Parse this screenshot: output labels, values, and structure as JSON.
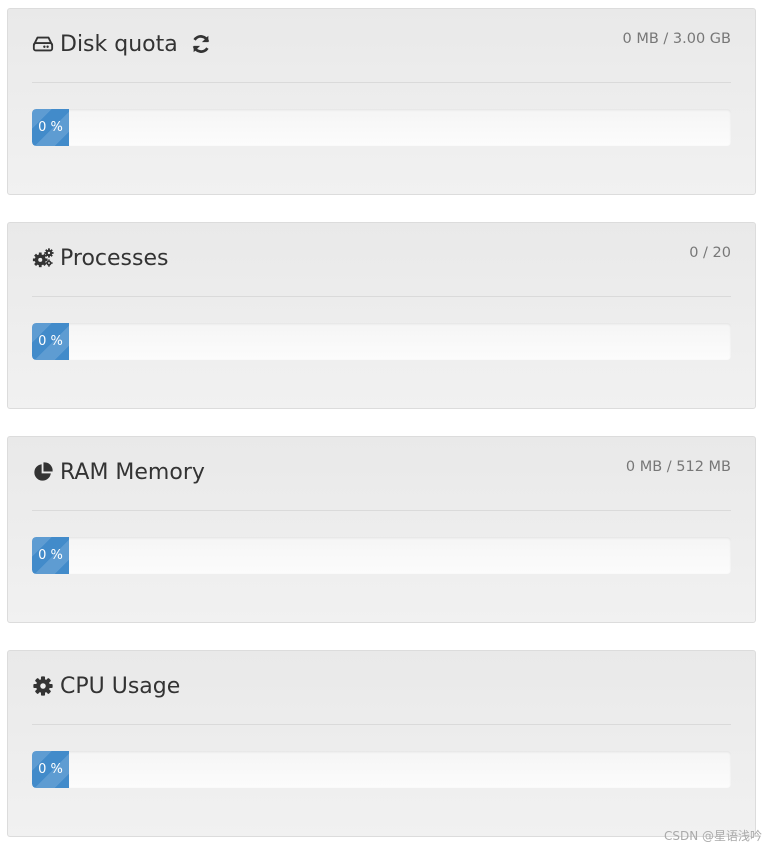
{
  "panels": [
    {
      "title": "Disk quota",
      "icon": "hdd-icon",
      "stat": "0 MB / 3.00 GB",
      "progress_label": "0 %",
      "progress_fraction": 0,
      "has_refresh": true
    },
    {
      "title": "Processes",
      "icon": "gears-icon",
      "stat": "0 / 20",
      "progress_label": "0 %",
      "progress_fraction": 0,
      "has_refresh": false
    },
    {
      "title": "RAM Memory",
      "icon": "pie-chart-icon",
      "stat": "0 MB / 512 MB",
      "progress_label": "0 %",
      "progress_fraction": 0,
      "has_refresh": false
    },
    {
      "title": "CPU Usage",
      "icon": "gear-icon",
      "stat": "",
      "progress_label": "0 %",
      "progress_fraction": 0,
      "has_refresh": false
    }
  ],
  "colors": {
    "progress": "#428bca",
    "title": "#333333",
    "stat": "#777777"
  },
  "watermark": "CSDN @星语浅吟"
}
